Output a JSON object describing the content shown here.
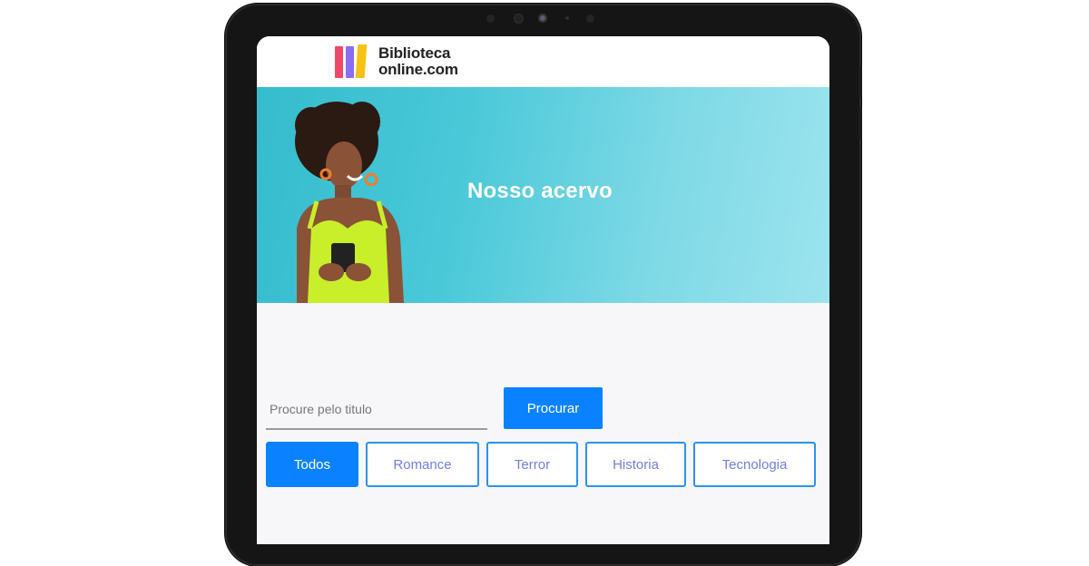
{
  "brand": {
    "line1": "Biblioteca",
    "line2": "online.com"
  },
  "hero": {
    "title": "Nosso acervo"
  },
  "search": {
    "placeholder": "Procure pelo titulo",
    "value": "",
    "button_label": "Procurar"
  },
  "filters": [
    {
      "label": "Todos",
      "active": true
    },
    {
      "label": "Romance",
      "active": false
    },
    {
      "label": "Terror",
      "active": false
    },
    {
      "label": "Historia",
      "active": false
    },
    {
      "label": "Tecnologia",
      "active": false
    }
  ],
  "colors": {
    "accent": "#0a82ff",
    "chip_border": "#2b92ef",
    "chip_text": "#6f7fe0",
    "hero_bg": "#49c8d8",
    "logo_pink": "#f0476c",
    "logo_purple": "#8a6df2",
    "logo_yellow": "#f6c315"
  }
}
